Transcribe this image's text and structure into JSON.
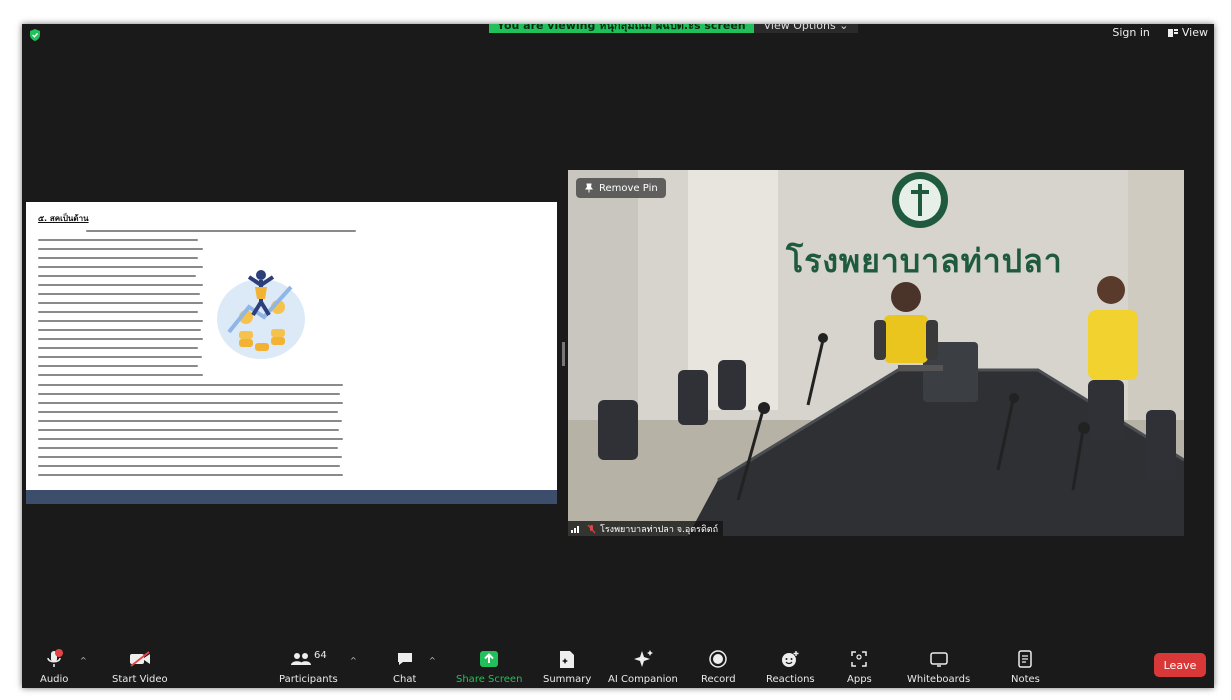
{
  "banner": {
    "viewing_text": "You are viewing หนุกสุมณม ผฉปต.ะs screen",
    "view_options": "View Options"
  },
  "top_right": {
    "sign_in": "Sign in",
    "view": "View"
  },
  "shared_doc": {
    "heading": "๕. สคเป็นด้าน"
  },
  "video": {
    "remove_pin": "Remove Pin",
    "sign_text": "โรงพยาบาลท่าปลา",
    "participant_name": "โรงพยาบาลท่าปลา จ.อุตรดิตถ์"
  },
  "toolbar": {
    "audio": "Audio",
    "start_video": "Start Video",
    "participants": "Participants",
    "participants_count": "64",
    "chat": "Chat",
    "share_screen": "Share Screen",
    "summary": "Summary",
    "ai_companion": "AI Companion",
    "record": "Record",
    "reactions": "Reactions",
    "apps": "Apps",
    "whiteboards": "Whiteboards",
    "notes": "Notes",
    "leave": "Leave"
  },
  "colors": {
    "accent_green": "#22c05a",
    "leave_red": "#d93838",
    "toolbar_bg": "#1a1a1a"
  }
}
